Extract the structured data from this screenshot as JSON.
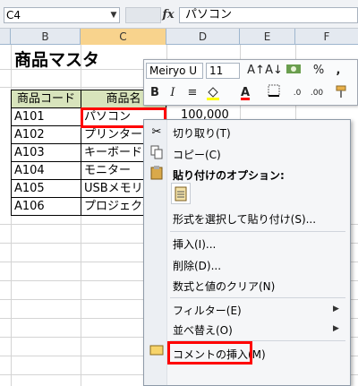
{
  "formula_bar": {
    "name_box": "C4",
    "fx": "fx",
    "content": "パソコン"
  },
  "columns": [
    "B",
    "C",
    "D",
    "E",
    "F"
  ],
  "sheet": {
    "title": "商品マスタ",
    "headers": [
      "商品コード",
      "商品名"
    ],
    "rows": [
      {
        "code": "A101",
        "name": "パソコン"
      },
      {
        "code": "A102",
        "name": "プリンター"
      },
      {
        "code": "A103",
        "name": "キーボード"
      },
      {
        "code": "A104",
        "name": "モニター"
      },
      {
        "code": "A105",
        "name": "USBメモリー"
      },
      {
        "code": "A106",
        "name": "プロジェクター"
      }
    ],
    "d4_value": "100,000"
  },
  "mini_toolbar": {
    "font": "Meiryo U",
    "size": "11",
    "row1": [
      "A↑",
      "A↓",
      "currency-icon",
      "%",
      ","
    ],
    "row2": [
      "B",
      "I",
      "align-icon",
      "fill-color-icon",
      "A",
      "borders-icon",
      "decimal-icon",
      "format-painter-icon"
    ]
  },
  "context_menu": {
    "cut": "切り取り(T)",
    "copy": "コピー(C)",
    "paste_options": "貼り付けのオプション:",
    "paste_special": "形式を選択して貼り付け(S)...",
    "insert": "挿入(I)...",
    "delete": "削除(D)...",
    "clear": "数式と値のクリア(N)",
    "filter": "フィルター(E)",
    "sort": "並べ替え(O)",
    "insert_comment": "コメントの挿入(M)"
  }
}
